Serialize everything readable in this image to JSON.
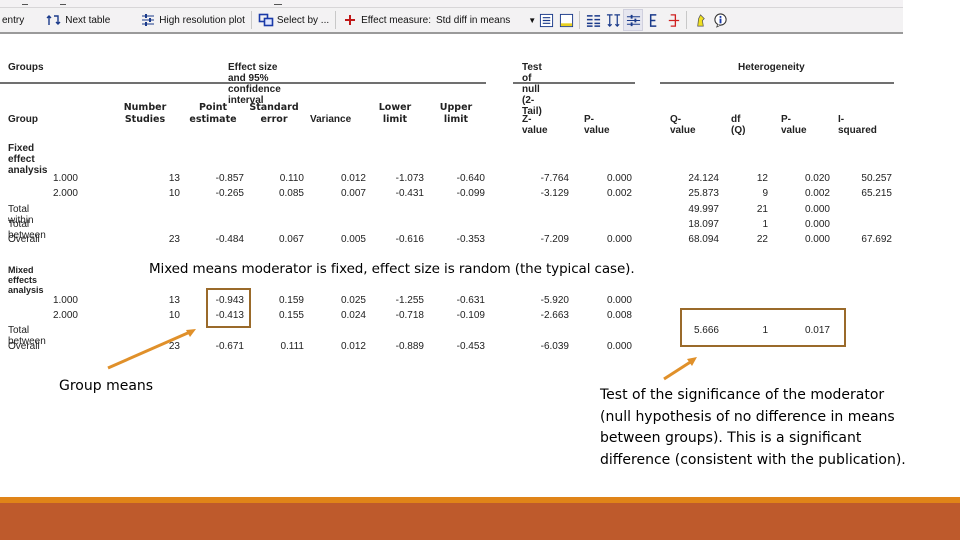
{
  "toolbar": {
    "items": [
      {
        "label": "entry",
        "icon": "none"
      },
      {
        "label": "Next table",
        "icon": "next-table-icon"
      },
      {
        "label": "High resolution plot",
        "icon": "high-resolution-plot-icon"
      },
      {
        "label": "Select by ...",
        "icon": "select-by-icon"
      },
      {
        "label": "Effect measure:",
        "icon": "plus-icon"
      }
    ],
    "effect_measure_value": "Std diff in means",
    "icon_buttons": [
      "show-table-icon",
      "show-footer-icon",
      "columns-icon",
      "sort-icon",
      "high-resolution-icon",
      "left-bracket-icon",
      "right-bracket-icon",
      "highlight-icon",
      "info-icon"
    ]
  },
  "table": {
    "group_headers": {
      "groups": "Groups",
      "effect": "Effect size and 95% confidence interval",
      "test_null": "Test of null (2-Tail)",
      "heterogeneity": "Heterogeneity"
    },
    "columns": {
      "group": "Group",
      "number_studies": [
        "Number",
        "Studies"
      ],
      "point_estimate": [
        "Point",
        "estimate"
      ],
      "standard_error": [
        "Standard",
        "error"
      ],
      "variance": "Variance",
      "lower_limit": [
        "Lower",
        "limit"
      ],
      "upper_limit": [
        "Upper",
        "limit"
      ],
      "z_value": "Z-value",
      "p_value": "P-value",
      "q_value": "Q-value",
      "df_q": "df (Q)",
      "het_p_value": "P-value",
      "i_squared": "I-squared"
    },
    "fixed": {
      "title": "Fixed effect analysis",
      "rows": [
        {
          "group": "1.000",
          "n": "13",
          "pe": "-0.857",
          "se": "0.110",
          "var": "0.012",
          "ll": "-1.073",
          "ul": "-0.640",
          "z": "-7.764",
          "p": "0.000",
          "q": "24.124",
          "df": "12",
          "hp": "0.020",
          "i2": "50.257"
        },
        {
          "group": "2.000",
          "n": "10",
          "pe": "-0.265",
          "se": "0.085",
          "var": "0.007",
          "ll": "-0.431",
          "ul": "-0.099",
          "z": "-3.129",
          "p": "0.002",
          "q": "25.873",
          "df": "9",
          "hp": "0.002",
          "i2": "65.215"
        },
        {
          "group": "Total within",
          "n": "",
          "pe": "",
          "se": "",
          "var": "",
          "ll": "",
          "ul": "",
          "z": "",
          "p": "",
          "q": "49.997",
          "df": "21",
          "hp": "0.000",
          "i2": ""
        },
        {
          "group": "Total between",
          "n": "",
          "pe": "",
          "se": "",
          "var": "",
          "ll": "",
          "ul": "",
          "z": "",
          "p": "",
          "q": "18.097",
          "df": "1",
          "hp": "0.000",
          "i2": ""
        },
        {
          "group": "Overall",
          "n": "23",
          "pe": "-0.484",
          "se": "0.067",
          "var": "0.005",
          "ll": "-0.616",
          "ul": "-0.353",
          "z": "-7.209",
          "p": "0.000",
          "q": "68.094",
          "df": "22",
          "hp": "0.000",
          "i2": "67.692"
        }
      ]
    },
    "mixed": {
      "title": "Mixed effects analysis",
      "rows": [
        {
          "group": "1.000",
          "n": "13",
          "pe": "-0.943",
          "se": "0.159",
          "var": "0.025",
          "ll": "-1.255",
          "ul": "-0.631",
          "z": "-5.920",
          "p": "0.000",
          "q": "",
          "df": "",
          "hp": "",
          "i2": ""
        },
        {
          "group": "2.000",
          "n": "10",
          "pe": "-0.413",
          "se": "0.155",
          "var": "0.024",
          "ll": "-0.718",
          "ul": "-0.109",
          "z": "-2.663",
          "p": "0.008",
          "q": "",
          "df": "",
          "hp": "",
          "i2": ""
        },
        {
          "group": "Total between",
          "n": "",
          "pe": "",
          "se": "",
          "var": "",
          "ll": "",
          "ul": "",
          "z": "",
          "p": "",
          "q": "5.666",
          "df": "1",
          "hp": "0.017",
          "i2": ""
        },
        {
          "group": "Overall",
          "n": "23",
          "pe": "-0.671",
          "se": "0.111",
          "var": "0.012",
          "ll": "-0.889",
          "ul": "-0.453",
          "z": "-6.039",
          "p": "0.000",
          "q": "",
          "df": "",
          "hp": "",
          "i2": ""
        }
      ]
    }
  },
  "annotations": {
    "mixed_note": "Mixed means moderator is fixed, effect size is random (the typical case).",
    "group_means": "Group means",
    "moderator_test": "Test of the significance of the moderator (null hypothesis of no difference in means between groups).  This is a significant difference (consistent with the publication).",
    "callout_color": "#9a6a2a",
    "arrow_color": "#e0902a"
  },
  "theme": {
    "footer_accent": "#e08418",
    "footer_bar": "#be5a2c"
  }
}
